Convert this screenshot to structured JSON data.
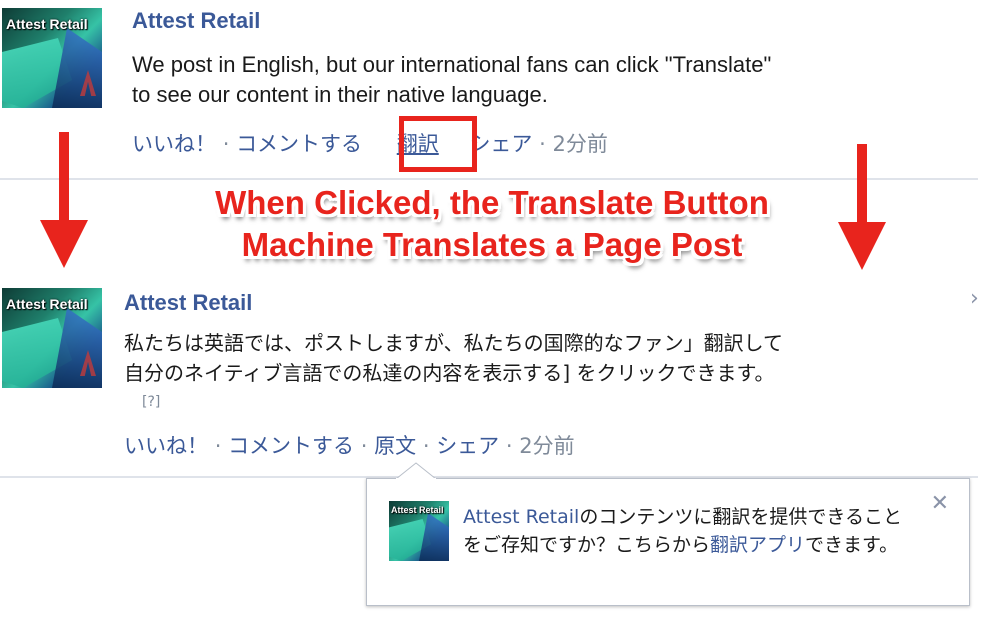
{
  "post1": {
    "avatar_logo_text": "Attest Retail",
    "page_name": "Attest Retail",
    "text_line1": "We post in English, but our international fans can click \"Translate\"",
    "text_line2": "to see our content in their native language.",
    "actions": {
      "like": "いいね！",
      "sep": "·",
      "comment": "コメントする",
      "translate": "翻訳",
      "share": "シェア",
      "time": "2分前"
    }
  },
  "callout": {
    "line1": "When Clicked, the Translate Button",
    "line2": "Machine Translates a Page Post"
  },
  "post2": {
    "avatar_logo_text": "Attest Retail",
    "page_name": "Attest Retail",
    "text_line1": "私たちは英語では、ポストしますが、私たちの国際的なファン」翻訳して",
    "text_line2": "自分のネイティブ言語での私達の内容を表示する] をクリックできます。",
    "help_link": "[?]",
    "actions": {
      "like": "いいね！",
      "sep": "·",
      "comment": "コメントする",
      "original": "原文",
      "share": "シェア",
      "time": "2分前"
    },
    "edge_chevron": "›"
  },
  "popup": {
    "avatar_logo_text": "Attest Retail",
    "page_link": "Attest Retail",
    "text_a": "のコンテンツに翻訳を提供でき",
    "text_b": "ることをご存知ですか？こちらから",
    "app_link_a": "翻訳アプ",
    "app_link_b": "リ",
    "text_c": "できます。",
    "close": "✕"
  },
  "colors": {
    "link": "#3b5998",
    "annotation_red": "#e8241d",
    "meta_gray": "#7f8a99"
  }
}
